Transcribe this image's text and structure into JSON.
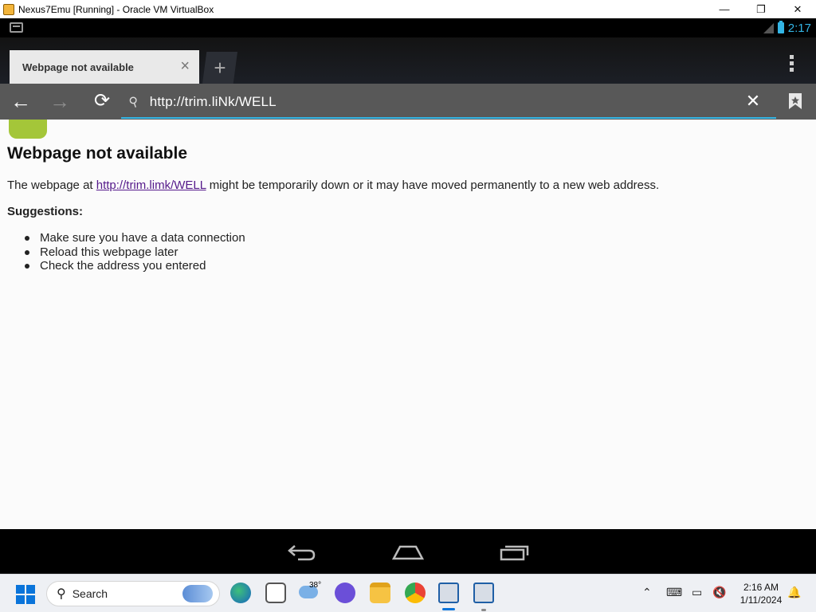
{
  "window": {
    "title": "Nexus7Emu [Running] - Oracle VM VirtualBox",
    "minimize_glyph": "—",
    "restore_glyph": "❐",
    "close_glyph": "✕"
  },
  "status_bar": {
    "time": "2:17",
    "accent_color": "#33b5e5"
  },
  "browser": {
    "tab_title": "Webpage not available",
    "tab_close_glyph": "×",
    "new_tab_glyph": "+",
    "back_glyph": "←",
    "forward_glyph": "→",
    "reload_glyph": "⟳",
    "url": "http://trim.liNk/WELL",
    "clear_glyph": "✕"
  },
  "page": {
    "title": "Webpage not available",
    "text_before": "The webpage at ",
    "link": "http://trim.limk/WELL",
    "text_after": " might be temporarily down or it may have moved permanently to a new web address.",
    "suggestions_title": "Suggestions:",
    "suggestions": [
      "Make sure you have a data connection",
      "Reload this webpage later",
      "Check the address you entered"
    ]
  },
  "taskbar": {
    "search_label": "Search",
    "weather_temp": "38°",
    "clock_time": "2:16 AM",
    "clock_date": "1/11/2024",
    "icons": [
      "windows-start-icon",
      "search-icon",
      "edge-pre-icon",
      "task-view-icon",
      "weather-icon",
      "meet-icon",
      "file-explorer-icon",
      "chrome-icon",
      "virtualbox-icon",
      "virtualbox-icon"
    ]
  }
}
